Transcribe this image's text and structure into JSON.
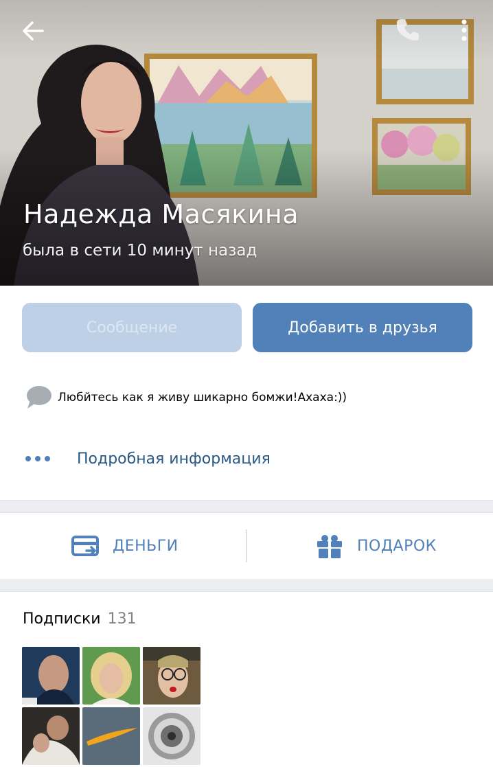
{
  "header": {
    "back_icon": "arrow-left-icon",
    "call_icon": "phone-icon",
    "more_icon": "more-vertical-icon"
  },
  "profile": {
    "name": "Надежда Масякина",
    "status": "была в сети 10 минут назад",
    "status_text": "Любйтесь как я живу шикарно бомжи!Ахаха:))"
  },
  "buttons": {
    "message_label": "Сообщение",
    "add_friend_label": "Добавить в друзья"
  },
  "more_info": {
    "label": "Подробная информация",
    "icon": "more-horizontal-icon"
  },
  "actions": {
    "money_label": "ДЕНЬГИ",
    "money_icon": "credit-card-icon",
    "gift_label": "ПОДАРОК",
    "gift_icon": "gift-icon"
  },
  "subscriptions": {
    "title": "Подписки",
    "count": "131",
    "items": [
      {
        "name": "subscription-thumb-1"
      },
      {
        "name": "subscription-thumb-2"
      },
      {
        "name": "subscription-thumb-3"
      },
      {
        "name": "subscription-thumb-4"
      },
      {
        "name": "subscription-thumb-5"
      },
      {
        "name": "subscription-thumb-6"
      }
    ]
  },
  "colors": {
    "accent": "#5181b8",
    "accent_light": "#bdd0e6",
    "link": "#2a5885",
    "background": "#ebedf0"
  }
}
